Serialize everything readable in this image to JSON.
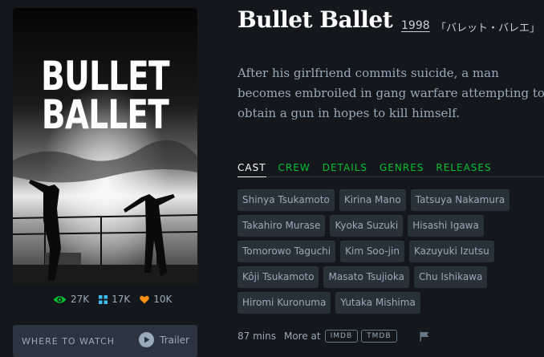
{
  "film": {
    "title": "Bullet Ballet",
    "year": "1998",
    "original_title": "「バレット・バレエ」",
    "synopsis": "After his girlfriend commits suicide, a man becomes embroiled in gang warfare attempting to obtain a gun in hopes to kill himself.",
    "runtime": "87 mins"
  },
  "poster": {
    "line1": "BULLET",
    "line2": "BALLET"
  },
  "stats": {
    "watched": "27K",
    "lists": "17K",
    "likes": "10K"
  },
  "where_to_watch": {
    "label": "WHERE TO WATCH",
    "trailer_label": "Trailer"
  },
  "tabs": [
    {
      "label": "CAST",
      "active": true
    },
    {
      "label": "CREW",
      "active": false
    },
    {
      "label": "DETAILS",
      "active": false
    },
    {
      "label": "GENRES",
      "active": false
    },
    {
      "label": "RELEASES",
      "active": false
    }
  ],
  "cast": [
    "Shinya Tsukamoto",
    "Kirina Mano",
    "Tatsuya Nakamura",
    "Takahiro Murase",
    "Kyoka Suzuki",
    "Hisashi Igawa",
    "Tomorowo Taguchi",
    "Kim Soo-jin",
    "Kazuyuki Izutsu",
    "Kôji Tsukamoto",
    "Masato Tsujioka",
    "Chu Ishikawa",
    "Hiromi Kuronuma",
    "Yutaka Mishima"
  ],
  "footer": {
    "more_at": "More at",
    "imdb": "IMDB",
    "tmdb": "TMDB"
  },
  "colors": {
    "background": "#14181c",
    "accent_green": "#00c030",
    "like_orange": "#ff9010",
    "list_blue": "#40bcf4"
  },
  "icons": {
    "watched": "eye-icon",
    "lists": "grid-icon",
    "likes": "heart-icon",
    "play": "play-icon",
    "report": "flag-icon"
  }
}
